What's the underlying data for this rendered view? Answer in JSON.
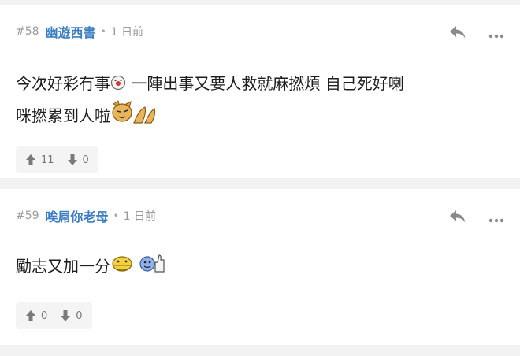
{
  "posts": [
    {
      "number": "#58",
      "username": "幽遊西書",
      "time": "1 日前",
      "content_line1": "今次好彩冇事",
      "content_line1b": " 一陣出事又要人救就麻撚煩 自己死好喇",
      "content_line2": "咪撚累到人啦",
      "upvotes": "11",
      "downvotes": "0"
    },
    {
      "number": "#59",
      "username": "唉屌你老母",
      "time": "1 日前",
      "content": "勵志又加一分",
      "upvotes": "0",
      "downvotes": "0"
    }
  ],
  "icons": {
    "reply": "reply-icon",
    "more": "more-icon",
    "upvote": "arrow-up-icon",
    "downvote": "arrow-down-icon"
  },
  "colors": {
    "username": "#3b7ec2",
    "meta": "#9a9a9a",
    "separator": "#f2f2f2",
    "vote_bg": "#f4f4f4"
  }
}
